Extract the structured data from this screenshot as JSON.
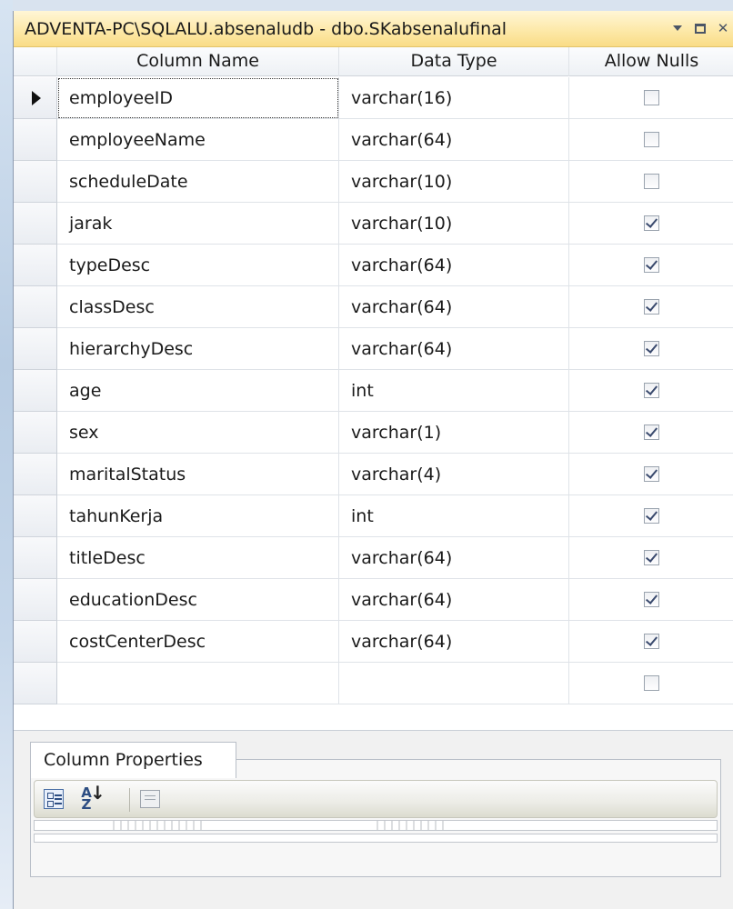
{
  "window": {
    "title": "ADVENTA-PC\\SQLALU.absenaludb - dbo.SKabsenalufinal"
  },
  "grid": {
    "headers": {
      "column_name": "Column Name",
      "data_type": "Data Type",
      "allow_nulls": "Allow Nulls"
    },
    "rows": [
      {
        "name": "employeeID",
        "type": "varchar(16)",
        "nulls": false
      },
      {
        "name": "employeeName",
        "type": "varchar(64)",
        "nulls": false
      },
      {
        "name": "scheduleDate",
        "type": "varchar(10)",
        "nulls": false
      },
      {
        "name": "jarak",
        "type": "varchar(10)",
        "nulls": true
      },
      {
        "name": "typeDesc",
        "type": "varchar(64)",
        "nulls": true
      },
      {
        "name": "classDesc",
        "type": "varchar(64)",
        "nulls": true
      },
      {
        "name": "hierarchyDesc",
        "type": "varchar(64)",
        "nulls": true
      },
      {
        "name": "age",
        "type": "int",
        "nulls": true
      },
      {
        "name": "sex",
        "type": "varchar(1)",
        "nulls": true
      },
      {
        "name": "maritalStatus",
        "type": "varchar(4)",
        "nulls": true
      },
      {
        "name": "tahunKerja",
        "type": "int",
        "nulls": true
      },
      {
        "name": "titleDesc",
        "type": "varchar(64)",
        "nulls": true
      },
      {
        "name": "educationDesc",
        "type": "varchar(64)",
        "nulls": true
      },
      {
        "name": "costCenterDesc",
        "type": "varchar(64)",
        "nulls": true
      },
      {
        "name": "",
        "type": "",
        "nulls": false
      }
    ]
  },
  "properties": {
    "tab_label": "Column Properties"
  },
  "icons": {
    "dropdown": "window-position-dropdown-icon",
    "maximize": "maximize-icon",
    "close": "close-icon",
    "categorized": "categorized-view-icon",
    "alphabetical": "alphabetical-sort-icon",
    "property_pages": "property-pages-icon"
  }
}
